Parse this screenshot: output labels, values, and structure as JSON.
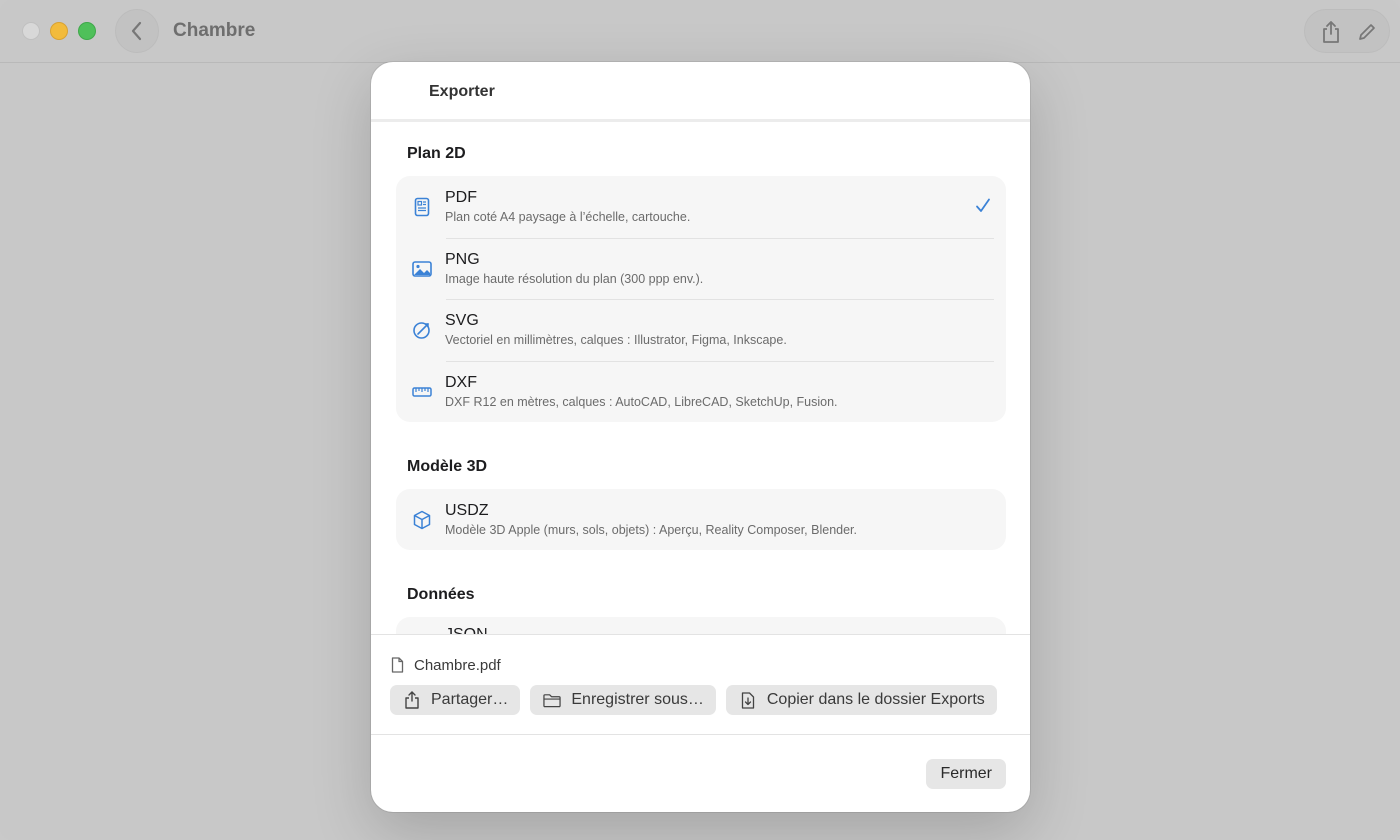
{
  "window": {
    "title": "Chambre"
  },
  "modal": {
    "title": "Exporter",
    "sections": [
      {
        "title": "Plan 2D",
        "items": [
          {
            "name": "PDF",
            "description": "Plan coté A4 paysage à l’échelle, cartouche.",
            "icon": "document-icon",
            "selected": true
          },
          {
            "name": "PNG",
            "description": "Image haute résolution du plan (300 ppp env.).",
            "icon": "image-icon",
            "selected": false
          },
          {
            "name": "SVG",
            "description": "Vectoriel en millimètres, calques : Illustrator, Figma, Inkscape.",
            "icon": "vector-pen-icon",
            "selected": false
          },
          {
            "name": "DXF",
            "description": "DXF R12 en mètres, calques : AutoCAD, LibreCAD, SketchUp, Fusion.",
            "icon": "ruler-icon",
            "selected": false
          }
        ]
      },
      {
        "title": "Modèle 3D",
        "items": [
          {
            "name": "USDZ",
            "description": "Modèle 3D Apple (murs, sols, objets) : Aperçu, Reality Composer, Blender.",
            "icon": "cube-icon",
            "selected": false
          }
        ]
      },
      {
        "title": "Données",
        "items": [
          {
            "name": "JSON",
            "description": "",
            "icon": "",
            "selected": false
          }
        ]
      }
    ],
    "filename": "Chambre.pdf",
    "actions": {
      "share": "Partager…",
      "save_as": "Enregistrer sous…",
      "copy_exports": "Copier dans le dossier Exports"
    },
    "close_label": "Fermer"
  },
  "colors": {
    "accent": "#3b82d6",
    "background": "#c8c8c8",
    "sheet": "#ffffff"
  }
}
